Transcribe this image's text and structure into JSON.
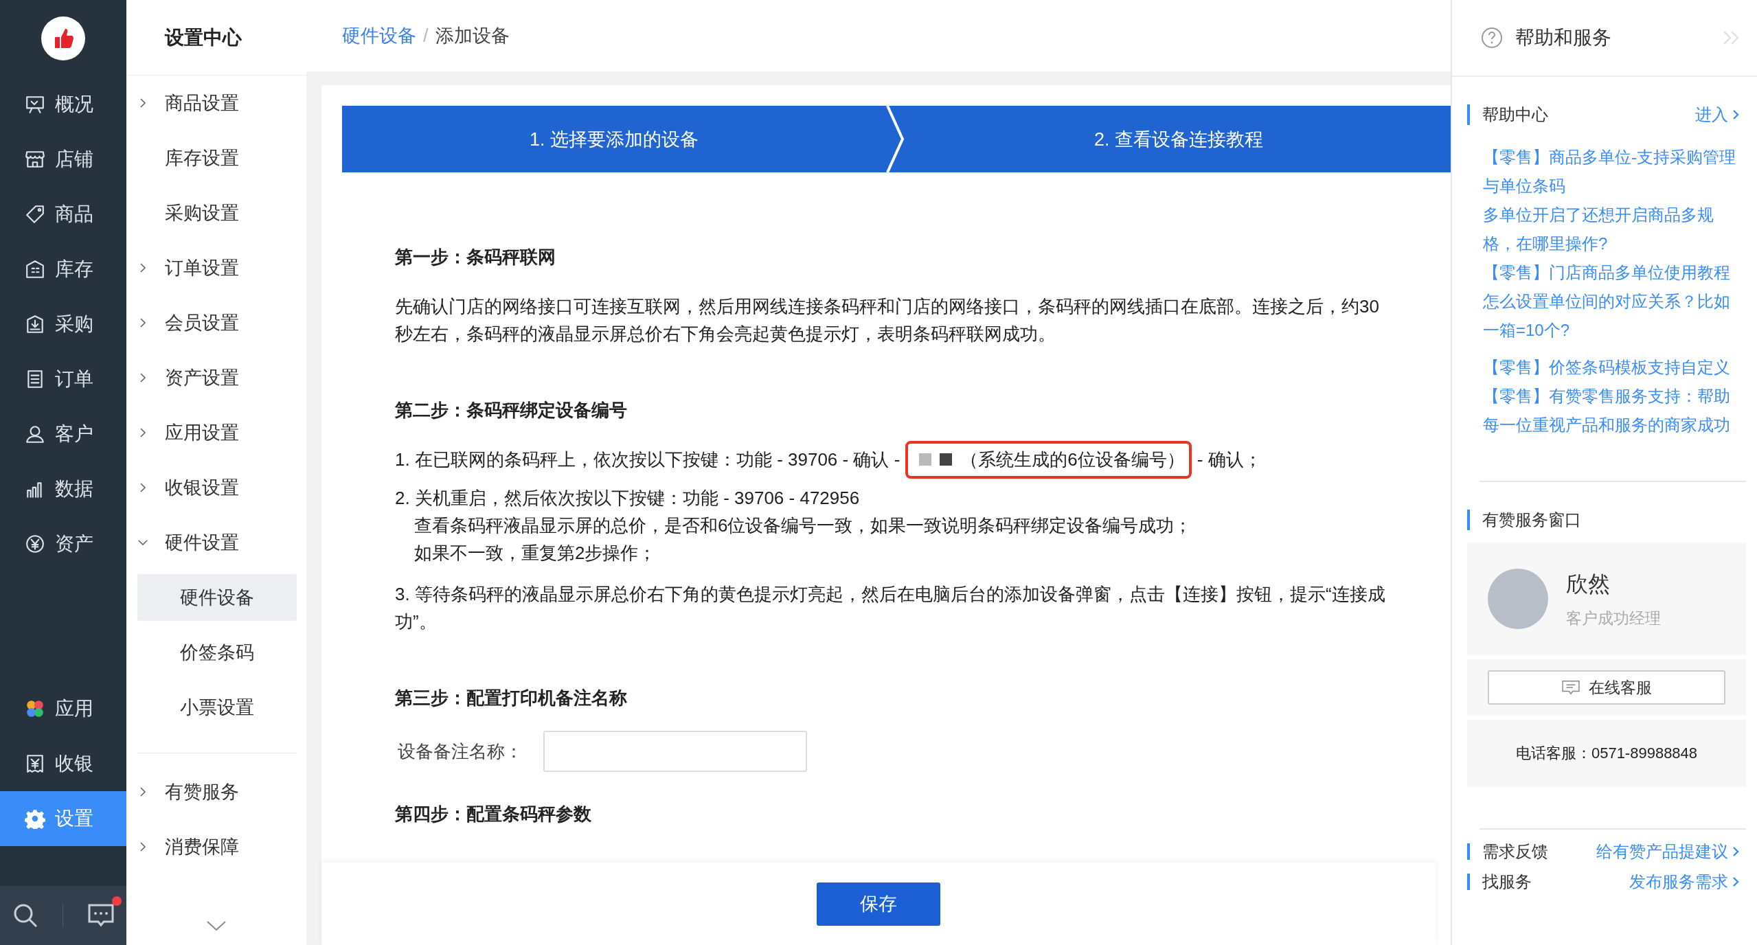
{
  "nav": {
    "items": [
      {
        "label": "概况",
        "selected": false
      },
      {
        "label": "店铺",
        "selected": false
      },
      {
        "label": "商品",
        "selected": false
      },
      {
        "label": "库存",
        "selected": false
      },
      {
        "label": "采购",
        "selected": false
      },
      {
        "label": "订单",
        "selected": false
      },
      {
        "label": "客户",
        "selected": false
      },
      {
        "label": "数据",
        "selected": false
      },
      {
        "label": "资产",
        "selected": false
      }
    ],
    "bottom_items": [
      {
        "label": "应用",
        "selected": false
      },
      {
        "label": "收银",
        "selected": false
      },
      {
        "label": "设置",
        "selected": true
      }
    ],
    "chat_unread": true
  },
  "settings_menu": {
    "title": "设置中心",
    "items": [
      {
        "label": "商品设置",
        "kind": "group",
        "expanded": false
      },
      {
        "label": "库存设置",
        "kind": "link"
      },
      {
        "label": "采购设置",
        "kind": "link"
      },
      {
        "label": "订单设置",
        "kind": "group",
        "expanded": false
      },
      {
        "label": "会员设置",
        "kind": "group",
        "expanded": false
      },
      {
        "label": "资产设置",
        "kind": "group",
        "expanded": false
      },
      {
        "label": "应用设置",
        "kind": "group",
        "expanded": false
      },
      {
        "label": "收银设置",
        "kind": "group",
        "expanded": false
      },
      {
        "label": "硬件设置",
        "kind": "group",
        "expanded": true,
        "children": [
          {
            "label": "硬件设备",
            "selected": true
          },
          {
            "label": "价签条码",
            "selected": false
          },
          {
            "label": "小票设置",
            "selected": false
          }
        ]
      }
    ],
    "extra_items": [
      {
        "label": "有赞服务",
        "kind": "group",
        "expanded": false
      },
      {
        "label": "消费保障",
        "kind": "group",
        "expanded": false
      }
    ]
  },
  "breadcrumb": {
    "items": [
      "硬件设备",
      "添加设备"
    ],
    "separator": "/"
  },
  "steps": [
    "1. 选择要添加的设备",
    "2. 查看设备连接教程"
  ],
  "step1": {
    "heading": "第一步：条码秤联网",
    "text": "先确认门店的网络接口可连接互联网，然后用网线连接条码秤和门店的网络接口，条码秤的网线插口在底部。连接之后，约30秒左右，条码秤的液晶显示屏总价右下角会亮起黄色提示灯，表明条码秤联网成功。"
  },
  "step2": {
    "heading": "第二步：条码秤绑定设备编号",
    "item1": {
      "before": "1. 在已联网的条码秤上，依次按以下按键：功能 - 39706 - 确认 -",
      "highlight": "（系统生成的6位设备编号）",
      "after": "- 确认；"
    },
    "item2": {
      "text": "2. 关机重启，然后依次按以下按键：功能 - 39706 - 472956",
      "notes": [
        "查看条码秤液晶显示屏的总价，是否和6位设备编号一致，如果一致说明条码秤绑定设备编号成功；",
        "如果不一致，重复第2步操作；"
      ]
    },
    "item3": "3. 等待条码秤的液晶显示屏总价右下角的黄色提示灯亮起，然后在电脑后台的添加设备弹窗，点击【连接】按钮，提示“连接成功”。"
  },
  "step3": {
    "heading": "第三步：配置打印机备注名称",
    "field_label": "设备备注名称："
  },
  "step4": {
    "heading": "第四步：配置条码秤参数"
  },
  "save_button": "保存",
  "help_panel": {
    "title": "帮助和服务",
    "help_center": {
      "title": "帮助中心",
      "link": "进入",
      "articles": [
        "【零售】商品多单位-支持采购管理与单位条码",
        "多单位开启了还想开启商品多规格，在哪里操作?",
        "【零售】门店商品多单位使用教程",
        "怎么设置单位间的对应关系？比如一箱=10个?"
      ],
      "articles_more": [
        "【零售】价签条码模板支持自定义",
        "【零售】有赞零售服务支持：帮助每一位重视产品和服务的商家成功"
      ]
    },
    "service": {
      "title": "有赞服务窗口",
      "name": "欣然",
      "role": "客户成功经理",
      "chat_button": "在线客服",
      "phone": "电话客服：0571-89988848"
    },
    "links": [
      {
        "label": "需求反馈",
        "link": "给有赞产品提建议"
      },
      {
        "label": "找服务",
        "link": "发布服务需求"
      }
    ]
  }
}
